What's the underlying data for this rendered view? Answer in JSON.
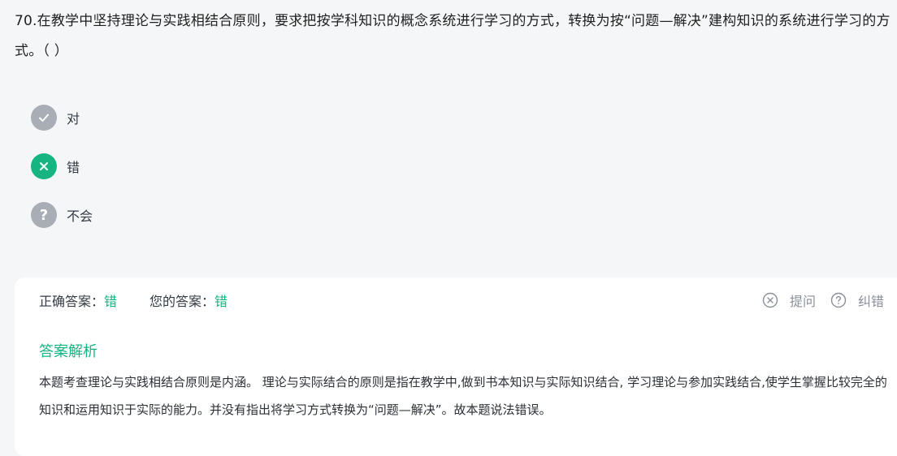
{
  "question": {
    "text": "70.在教学中坚持理论与实践相结合原则，要求把按学科知识的概念系统进行学习的方式，转换为按“问题—解决”建构知识的系统进行学习的方式。（ ）"
  },
  "options": [
    {
      "label": "对",
      "icon": "check-icon",
      "state": "neutral",
      "color": "#a9adb5"
    },
    {
      "label": "错",
      "icon": "close-icon",
      "state": "selected",
      "color": "#16b481"
    },
    {
      "label": "不会",
      "icon": "question-icon",
      "state": "neutral",
      "color": "#a9adb5"
    }
  ],
  "result": {
    "correct_label": "正确答案：",
    "correct_value": "错",
    "your_label": "您的答案：",
    "your_value": "错",
    "ask_label": "提问",
    "report_label": "纠错"
  },
  "analysis": {
    "title": "答案解析",
    "text": "本题考查理论与实践相结合原则是内涵。 理论与实际结合的原则是指在教学中,做到书本知识与实际知识结合, 学习理论与参加实践结合,使学生掌握比较完全的知识和运用知识于实际的能力。并没有指出将学习方式转换为“问题—解决”。故本题说法错误。"
  },
  "colors": {
    "accent": "#16b481",
    "neutral_icon": "#a9adb5",
    "background": "#f5f6f7"
  }
}
